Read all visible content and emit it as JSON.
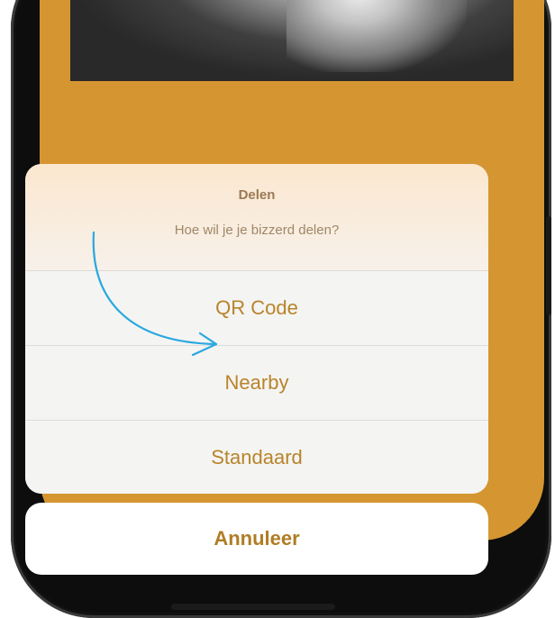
{
  "action_sheet": {
    "title": "Delen",
    "message": "Hoe wil je je bizzerd delen?",
    "options": [
      {
        "label": "QR Code"
      },
      {
        "label": "Nearby"
      },
      {
        "label": "Standaard"
      }
    ],
    "cancel_label": "Annuleer"
  },
  "colors": {
    "accent": "#d18a1a",
    "option_text": "#b8842b",
    "annotation_arrow": "#2aa8e0"
  }
}
